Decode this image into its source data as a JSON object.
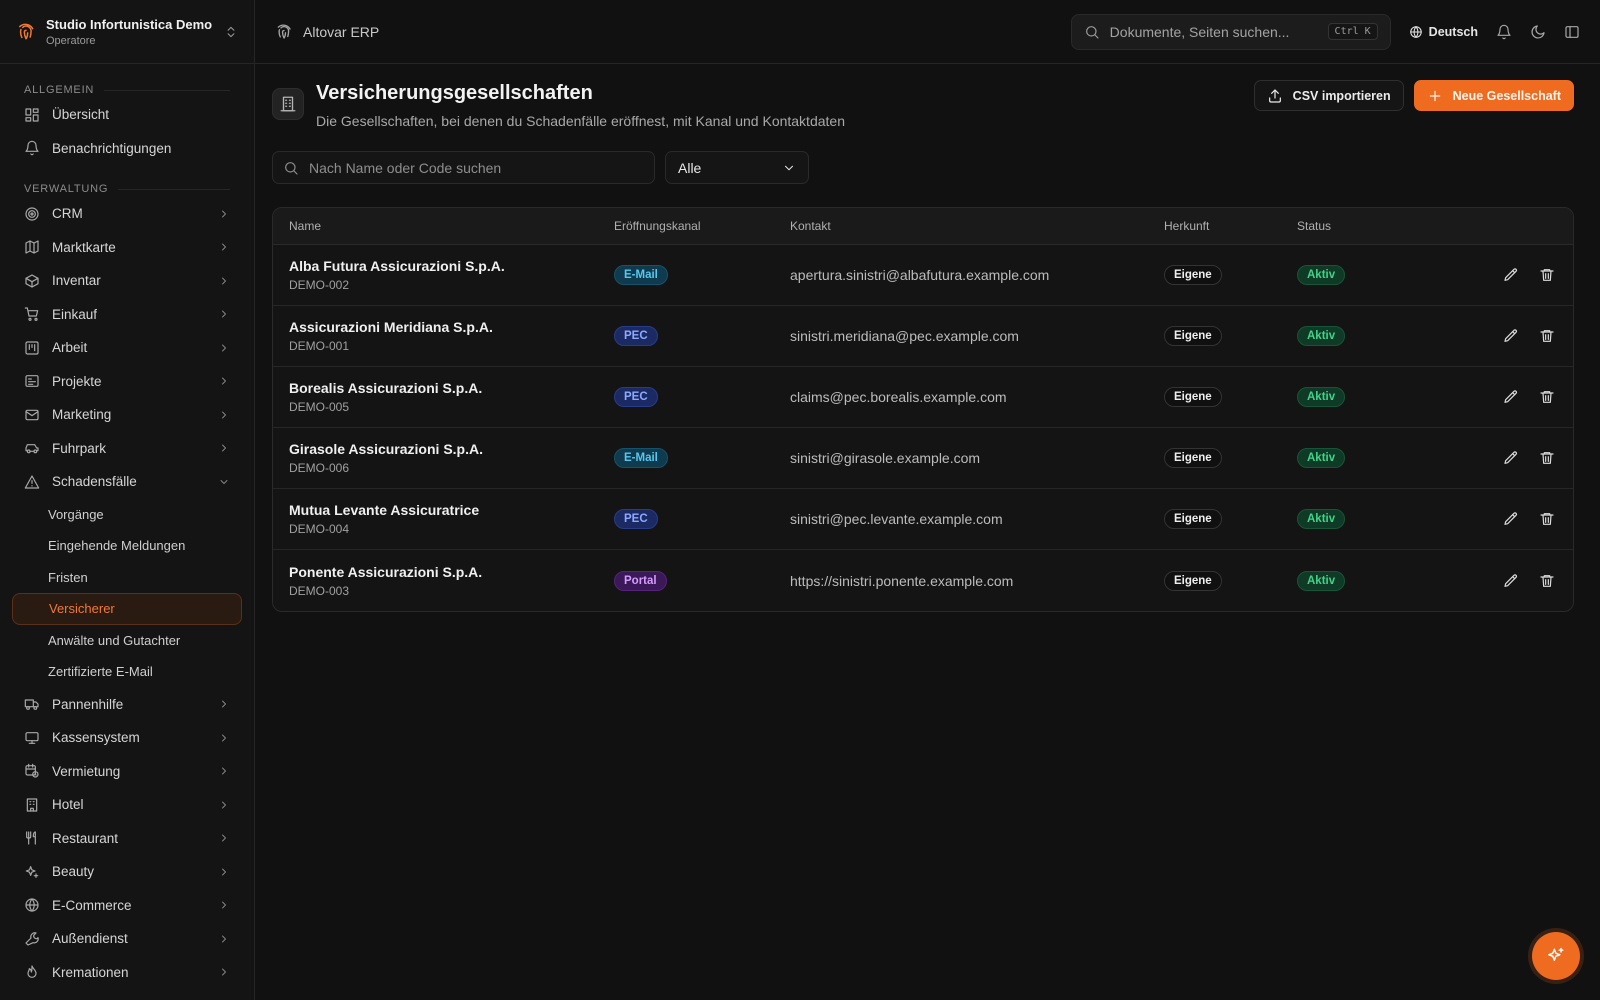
{
  "org": {
    "name": "Studio Infortunistica Demo",
    "role": "Operatore"
  },
  "topbar": {
    "app_name": "Altovar ERP",
    "search_placeholder": "Dokumente, Seiten suchen...",
    "shortcut": "Ctrl K",
    "language": "Deutsch"
  },
  "sidebar": {
    "section_general": "ALLGEMEIN",
    "general_items": [
      {
        "label": "Übersicht",
        "icon": "dashboard-icon"
      },
      {
        "label": "Benachrichtigungen",
        "icon": "bell-icon"
      }
    ],
    "section_admin": "VERWALTUNG",
    "admin_items": [
      {
        "label": "CRM",
        "icon": "target-icon"
      },
      {
        "label": "Marktkarte",
        "icon": "map-icon"
      },
      {
        "label": "Inventar",
        "icon": "box-icon"
      },
      {
        "label": "Einkauf",
        "icon": "cart-icon"
      },
      {
        "label": "Arbeit",
        "icon": "kanban-icon"
      },
      {
        "label": "Projekte",
        "icon": "project-icon"
      },
      {
        "label": "Marketing",
        "icon": "mail-icon"
      },
      {
        "label": "Fuhrpark",
        "icon": "car-icon"
      },
      {
        "label": "Schadensfälle",
        "icon": "warning-icon"
      }
    ],
    "claims_sub": [
      "Vorgänge",
      "Eingehende Meldungen",
      "Fristen",
      "Versicherer",
      "Anwälte und Gutachter",
      "Zertifizierte E-Mail"
    ],
    "more_items": [
      {
        "label": "Pannenhilfe",
        "icon": "truck-icon"
      },
      {
        "label": "Kassensystem",
        "icon": "monitor-icon"
      },
      {
        "label": "Vermietung",
        "icon": "calendar-clock-icon"
      },
      {
        "label": "Hotel",
        "icon": "building-icon"
      },
      {
        "label": "Restaurant",
        "icon": "utensils-icon"
      },
      {
        "label": "Beauty",
        "icon": "sparkles-icon"
      },
      {
        "label": "E-Commerce",
        "icon": "globe-icon"
      },
      {
        "label": "Außendienst",
        "icon": "wrench-icon"
      },
      {
        "label": "Kremationen",
        "icon": "flame-icon"
      }
    ]
  },
  "page": {
    "title": "Versicherungsgesellschaften",
    "subtitle": "Die Gesellschaften, bei denen du Schadenfälle eröffnest, mit Kanal und Kontaktdaten",
    "import_label": "CSV importieren",
    "new_label": "Neue Gesellschaft",
    "search_placeholder": "Nach Name oder Code suchen",
    "filter_value": "Alle"
  },
  "table": {
    "headers": [
      "Name",
      "Eröffnungskanal",
      "Kontakt",
      "Herkunft",
      "Status"
    ],
    "rows": [
      {
        "name": "Alba Futura Assicurazioni S.p.A.",
        "code": "DEMO-002",
        "channel": "E-Mail",
        "contact": "apertura.sinistri@albafutura.example.com",
        "origin": "Eigene",
        "status": "Aktiv"
      },
      {
        "name": "Assicurazioni Meridiana S.p.A.",
        "code": "DEMO-001",
        "channel": "PEC",
        "contact": "sinistri.meridiana@pec.example.com",
        "origin": "Eigene",
        "status": "Aktiv"
      },
      {
        "name": "Borealis Assicurazioni S.p.A.",
        "code": "DEMO-005",
        "channel": "PEC",
        "contact": "claims@pec.borealis.example.com",
        "origin": "Eigene",
        "status": "Aktiv"
      },
      {
        "name": "Girasole Assicurazioni S.p.A.",
        "code": "DEMO-006",
        "channel": "E-Mail",
        "contact": "sinistri@girasole.example.com",
        "origin": "Eigene",
        "status": "Aktiv"
      },
      {
        "name": "Mutua Levante Assicuratrice",
        "code": "DEMO-004",
        "channel": "PEC",
        "contact": "sinistri@pec.levante.example.com",
        "origin": "Eigene",
        "status": "Aktiv"
      },
      {
        "name": "Ponente Assicurazioni S.p.A.",
        "code": "DEMO-003",
        "channel": "Portal",
        "contact": "https://sinistri.ponente.example.com",
        "origin": "Eigene",
        "status": "Aktiv"
      }
    ]
  },
  "colors": {
    "accent": "#ef6b20",
    "background": "#111111",
    "active_green": "#3fd488"
  }
}
